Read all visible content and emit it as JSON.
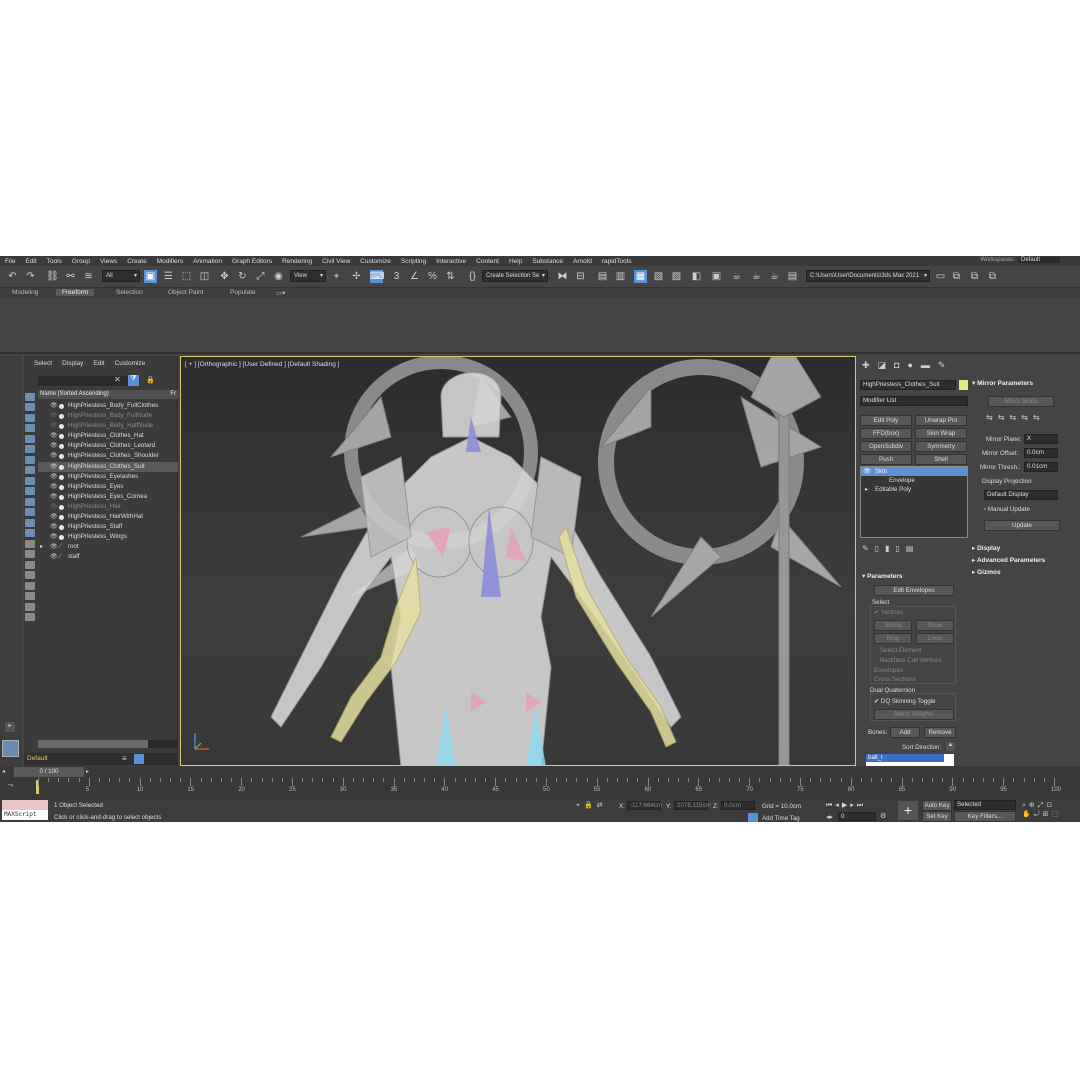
{
  "menu": [
    "File",
    "Edit",
    "Tools",
    "Group",
    "Views",
    "Create",
    "Modifiers",
    "Animation",
    "Graph Editors",
    "Rendering",
    "Civil View",
    "Customize",
    "Scripting",
    "Interactive",
    "Content",
    "Help",
    "Substance",
    "Arnold",
    "rapidTools"
  ],
  "workspaces": {
    "label": "Workspaces:",
    "value": "Default"
  },
  "toolbar": {
    "selection_filter": "All",
    "ref_coord": "View",
    "named_selection": "Create Selection Se",
    "project_path": "C:\\Users\\User\\Documents\\3ds Max 2021"
  },
  "ribbon_tabs": [
    "Modeling",
    "Freeform",
    "Selection",
    "Object Paint",
    "Populate"
  ],
  "ribbon_active": "Freeform",
  "explorer": {
    "menu": [
      "Select",
      "Display",
      "Edit",
      "Customize"
    ],
    "column_header": "Name (Sorted Ascending)",
    "column_header2": "Fr",
    "items": [
      {
        "name": "HighPriestess_Body_FullClothes",
        "dim": false,
        "sel": false
      },
      {
        "name": "HighPriestess_Body_FullNude",
        "dim": true,
        "sel": false
      },
      {
        "name": "HighPriestess_Body_HalfNude",
        "dim": true,
        "sel": false
      },
      {
        "name": "HighPriestess_Clothes_Hat",
        "dim": false,
        "sel": false
      },
      {
        "name": "HighPriestess_Clothes_Leotard",
        "dim": false,
        "sel": false
      },
      {
        "name": "HighPriestess_Clothes_Shoulder",
        "dim": false,
        "sel": false
      },
      {
        "name": "HighPriestess_Clothes_Suit",
        "dim": false,
        "sel": true
      },
      {
        "name": "HighPriestess_Eyelashes",
        "dim": false,
        "sel": false
      },
      {
        "name": "HighPriestess_Eyes",
        "dim": false,
        "sel": false
      },
      {
        "name": "HighPriestess_Eyes_Cornea",
        "dim": false,
        "sel": false
      },
      {
        "name": "HighPriestess_Hair",
        "dim": true,
        "sel": false
      },
      {
        "name": "HighPriestess_HairWithHat",
        "dim": false,
        "sel": false
      },
      {
        "name": "HighPriestess_Staff",
        "dim": false,
        "sel": false
      },
      {
        "name": "HighPriestess_Wings",
        "dim": false,
        "sel": false
      },
      {
        "name": "root",
        "dim": false,
        "sel": false
      },
      {
        "name": "staff",
        "dim": false,
        "sel": false
      }
    ],
    "layer": "Default"
  },
  "viewport": {
    "label": "[ + ] [Orthographic ] [User Defined ] [Default Shading ]"
  },
  "command_panel": {
    "object_name": "HighPriestess_Clothes_Suit",
    "modifier_list": "Modifier List",
    "mod_buttons": [
      "Edit Poly",
      "Unwrap Pro",
      "FFD(box)",
      "Skin Wrap",
      "OpenSubdiv",
      "Symmetry",
      "Push",
      "Shell"
    ],
    "stack": [
      "Skin",
      "Envelope",
      "Editable Poly"
    ],
    "parameters_title": "Parameters",
    "edit_envelopes": "Edit Envelopes",
    "select_title": "Select",
    "vertices": "Vertices",
    "shrink": "Shrink",
    "grow": "Grow",
    "ring": "Ring",
    "loop": "Loop",
    "select_element": "Select Element",
    "backface": "Backface Cull Vertices",
    "envelopes": "Envelopes",
    "cross_sections": "Cross Sections",
    "dual_q": "Dual Quaternion",
    "dq_toggle": "DQ Skinning Toggle",
    "blend_weights": "Blend Weights",
    "bones_label": "Bones:",
    "add": "Add",
    "remove": "Remove",
    "sort_direction": "Sort Direction:",
    "bone_selected": "ball_l"
  },
  "mirror": {
    "title": "Mirror Parameters",
    "mirror_mode": "Mirror Mode",
    "plane_label": "Mirror Plane:",
    "plane_value": "X",
    "offset_label": "Mirror Offset:",
    "offset_value": "0.0cm",
    "thresh_label": "Mirror Thresh.:",
    "thresh_value": "0.01cm",
    "proj_label": "Display Projection",
    "proj_value": "Default Display",
    "manual": "Manual Update",
    "update": "Update",
    "rollouts": [
      "Display",
      "Advanced Parameters",
      "Gizmos"
    ]
  },
  "timeline": {
    "frame": "0 / 100",
    "ticks": [
      "5",
      "10",
      "15",
      "20",
      "25",
      "30",
      "35",
      "40",
      "45",
      "50",
      "55",
      "60",
      "65",
      "70",
      "75",
      "80",
      "85",
      "90",
      "95",
      "100"
    ]
  },
  "status": {
    "maxscript": "MAXScript",
    "selected": "1 Object Selected",
    "hint": "Click or click-and-drag to select objects",
    "x_label": "X:",
    "x_value": "-117.664cm",
    "y_label": "Y:",
    "y_value": "2076.115cm",
    "z_label": "Z:",
    "z_value": "0.0cm",
    "grid": "Grid = 10.0cm",
    "add_time_tag": "Add Time Tag",
    "auto_key": "Auto Key",
    "set_key": "Set Key",
    "key_mode": "Selected",
    "key_filters": "Key Filters...",
    "frame_field": "0"
  }
}
